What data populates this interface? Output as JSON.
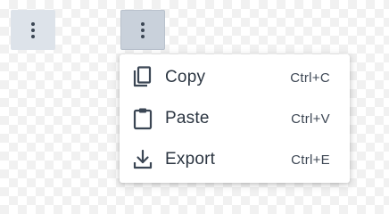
{
  "buttons": {
    "first": {
      "icon": "kebab-menu-icon",
      "state": "idle"
    },
    "second": {
      "icon": "kebab-menu-icon",
      "state": "active"
    }
  },
  "menu": {
    "items": [
      {
        "label": "Copy",
        "shortcut": "Ctrl+C",
        "icon": "copy-icon"
      },
      {
        "label": "Paste",
        "shortcut": "Ctrl+V",
        "icon": "clipboard-icon"
      },
      {
        "label": "Export",
        "shortcut": "Ctrl+E",
        "icon": "download-icon"
      }
    ]
  },
  "colors": {
    "button_idle_bg": "#dde3ea",
    "button_active_bg": "#c9d1db",
    "icon": "#3b4654",
    "text": "#2c3642"
  }
}
